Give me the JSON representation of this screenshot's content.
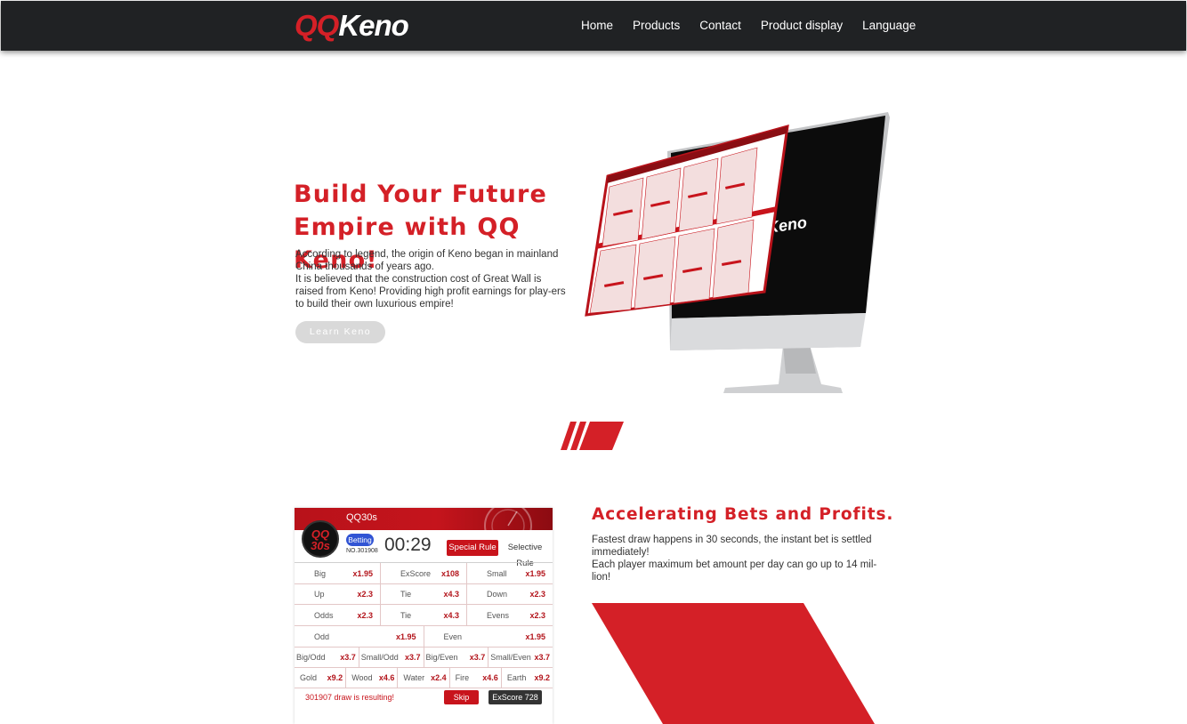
{
  "brand": {
    "logo_part1": "QQ",
    "logo_part2": "Keno",
    "accent_color": "#d42027",
    "navbar_color": "#202224"
  },
  "nav": {
    "items": [
      {
        "label": "Home"
      },
      {
        "label": "Products"
      },
      {
        "label": "Contact"
      },
      {
        "label": "Product display"
      },
      {
        "label": "Language"
      }
    ]
  },
  "hero": {
    "title_line1": "Build Your Future",
    "title_line2": "Empire with QQ Keno!",
    "paragraph1": "According to legend, the origin of Keno began in mainland China thousands of years ago.",
    "paragraph2": "It is believed that the construction cost of Great Wall is raised from Keno! Providing high profit earnings for play-ers to build their own luxurious empire!",
    "button_label": "Learn Keno"
  },
  "betting_panel": {
    "product_name": "QQ30s",
    "logo_line1": "QQ",
    "logo_line2": "30s",
    "status": "Betting",
    "draw_no": "NO.301908",
    "timer": "00:29",
    "special_rule_label": "Special Rule",
    "selective_rule_label": "Selective Rule",
    "rows": [
      [
        {
          "label": "Big",
          "odds": "x1.95"
        },
        {
          "label": "ExScore",
          "odds": "x108"
        },
        {
          "label": "Small",
          "odds": "x1.95"
        }
      ],
      [
        {
          "label": "Up",
          "odds": "x2.3"
        },
        {
          "label": "Tie",
          "odds": "x4.3"
        },
        {
          "label": "Down",
          "odds": "x2.3"
        }
      ],
      [
        {
          "label": "Odds",
          "odds": "x2.3"
        },
        {
          "label": "Tie",
          "odds": "x4.3"
        },
        {
          "label": "Evens",
          "odds": "x2.3"
        }
      ],
      [
        {
          "label": "Odd",
          "odds": "x1.95"
        },
        {
          "label": "Even",
          "odds": "x1.95"
        }
      ],
      [
        {
          "label": "Big/Odd",
          "odds": "x3.7"
        },
        {
          "label": "Small/Odd",
          "odds": "x3.7"
        },
        {
          "label": "Big/Even",
          "odds": "x3.7"
        },
        {
          "label": "Small/Even",
          "odds": "x3.7"
        }
      ],
      [
        {
          "label": "Gold",
          "odds": "x9.2"
        },
        {
          "label": "Wood",
          "odds": "x4.6"
        },
        {
          "label": "Water",
          "odds": "x2.4"
        },
        {
          "label": "Fire",
          "odds": "x4.6"
        },
        {
          "label": "Earth",
          "odds": "x9.2"
        }
      ]
    ],
    "result_text": "301907 draw is resulting!",
    "skip_label": "Skip",
    "exscore_label": "ExScore 728"
  },
  "section2": {
    "title": "Accelerating Bets and Profits.",
    "paragraph1": "Fastest draw happens in 30 seconds, the instant bet is settled immediately!",
    "paragraph2": "Each player maximum bet amount per day can go up to 14 mil-lion!"
  },
  "illustration": {
    "monitor_logo_text": "Keno"
  }
}
